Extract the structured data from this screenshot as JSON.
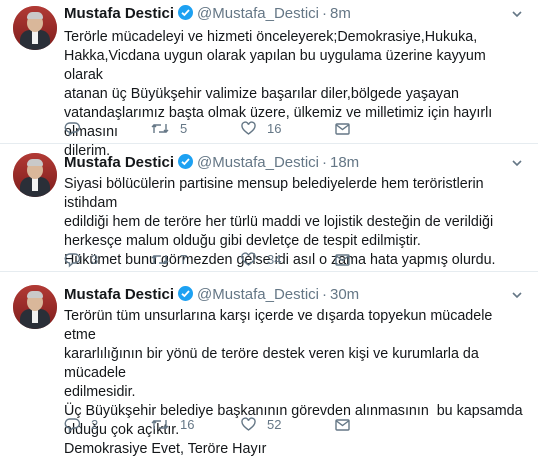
{
  "colors": {
    "accent": "#1da1f2",
    "muted": "#657786",
    "divider": "#e6ecf0"
  },
  "tweets": [
    {
      "author": "Mustafa Destici",
      "handle": "@Mustafa_Destici",
      "time": "8m",
      "text": "Terörle mücadeleyi ve hizmeti önceleyerek;Demokrasiye,Hukuka,\nHakka,Vicdana uygun olarak yapılan bu uygulama üzerine kayyum olarak\natanan üç Büyükşehir valimize başarılar diler,bölgede yaşayan\nvatandaşlarımız başta olmak üzere, ülkemiz ve milletimiz için hayırlı olmasını\ndilerim.",
      "replies": "",
      "retweets": "5",
      "likes": "16"
    },
    {
      "author": "Mustafa Destici",
      "handle": "@Mustafa_Destici",
      "time": "18m",
      "text": "Siyasi bölücülerin partisine mensup belediyelerde hem teröristlerin istihdam\nedildiği hem de teröre her türlü maddi ve lojistik desteğin de verildiği\nherkesçe malum olduğu gibi devletçe de tespit edilmiştir.\nHükümet bunu görmezden gelse idi asıl o zama hata yapmış olurdu.",
      "replies": "3",
      "retweets": "7",
      "likes": "34"
    },
    {
      "author": "Mustafa Destici",
      "handle": "@Mustafa_Destici",
      "time": "30m",
      "text": "Terörün tüm unsurlarına karşı içerde ve dışarda topyekun mücadele etme\nkararlılığının bir yönü de teröre destek veren kişi ve kurumlarla da mücadele\nedilmesidir.\nÜç Büyükşehir belediye başkanının görevden alınmasının  bu kapsamda\nolduğu çok açıktır.\nDemokrasiye Evet, Teröre Hayır",
      "replies": "2",
      "retweets": "16",
      "likes": "52"
    }
  ]
}
